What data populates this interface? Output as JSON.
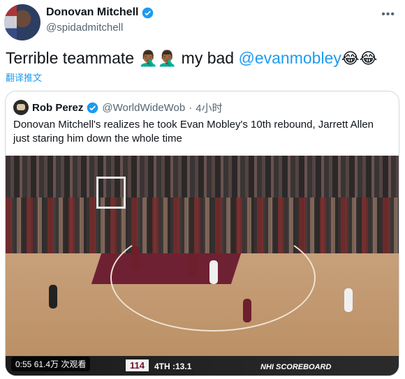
{
  "author": {
    "display_name": "Donovan Mitchell",
    "handle": "@spidadmitchell"
  },
  "tweet": {
    "text_before": "Terrible teammate ",
    "emoji_facepalm": "🤦🏾‍♂️🤦🏾‍♂️",
    "text_middle": " my bad ",
    "mention": "@evanmobley",
    "emoji_laugh": " 😂😂",
    "translate_label": "翻译推文"
  },
  "quoted": {
    "display_name": "Rob Perez",
    "handle": "@WorldWideWob",
    "separator": "·",
    "time": "4小时",
    "text": "Donovan Mitchell's realizes he took Evan Mobley's 10th rebound, Jarrett Allen just staring him down the whole time"
  },
  "video": {
    "duration": "0:55",
    "views": "61.4万 次观看",
    "score": "114",
    "quarter": "4TH",
    "clock": ":13.1",
    "scoreboard": "NHI SCOREBOARD"
  },
  "colors": {
    "link": "#1d9bf0",
    "verified": "#1d9bf0",
    "muted": "#536471"
  },
  "icons": [
    "verified-badge-icon",
    "more-icon"
  ]
}
